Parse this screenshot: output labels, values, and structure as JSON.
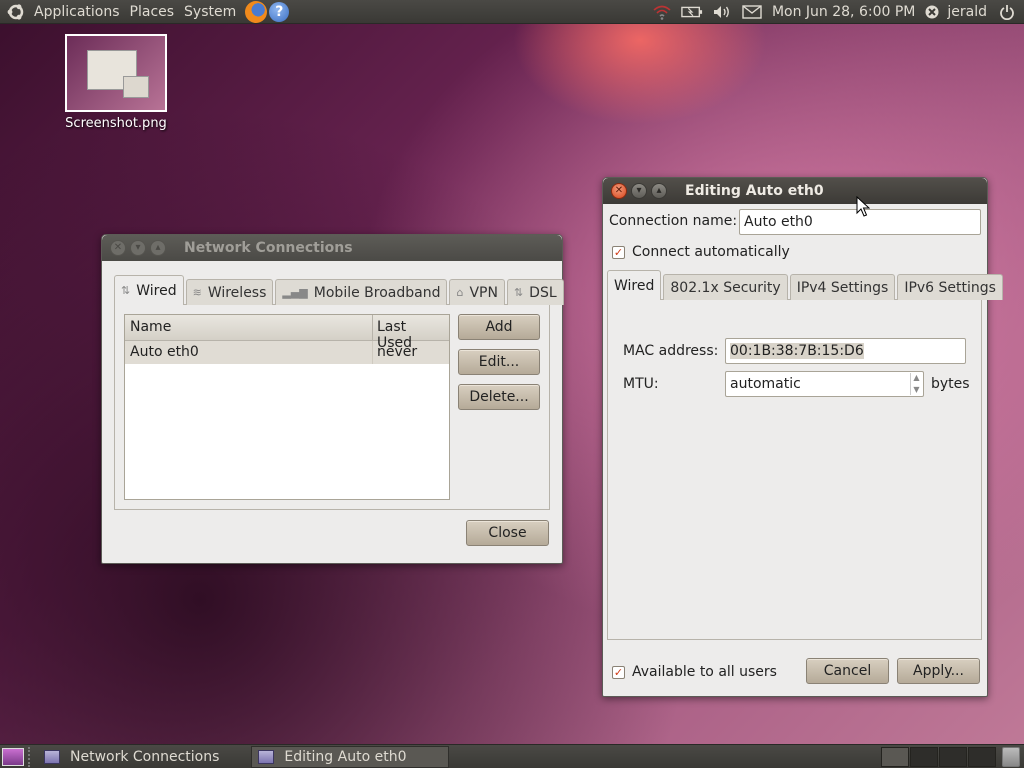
{
  "top_panel": {
    "menus": [
      "Applications",
      "Places",
      "System"
    ],
    "clock": "Mon Jun 28,  6:00 PM",
    "user": "jerald"
  },
  "desktop": {
    "icons": [
      {
        "label": "Screenshot.png"
      }
    ]
  },
  "network_window": {
    "title": "Network Connections",
    "tabs": [
      {
        "label": "Wired",
        "icon": "wired-icon"
      },
      {
        "label": "Wireless",
        "icon": "wireless-icon"
      },
      {
        "label": "Mobile Broadband",
        "icon": "mobile-broadband-icon"
      },
      {
        "label": "VPN",
        "icon": "vpn-lock-icon"
      },
      {
        "label": "DSL",
        "icon": "dsl-icon"
      }
    ],
    "table": {
      "columns": [
        "Name",
        "Last Used"
      ],
      "rows": [
        {
          "name": "Auto eth0",
          "last_used": "never"
        }
      ]
    },
    "buttons": {
      "add": "Add",
      "edit": "Edit...",
      "delete": "Delete...",
      "close": "Close"
    }
  },
  "edit_window": {
    "title": "Editing Auto eth0",
    "connection_name_label": "Connection name:",
    "connection_name_value": "Auto eth0",
    "connect_auto_label": "Connect automatically",
    "connect_auto_checked": true,
    "tabs": [
      "Wired",
      "802.1x Security",
      "IPv4 Settings",
      "IPv6 Settings"
    ],
    "mac_label": "MAC address:",
    "mac_value": "00:1B:38:7B:15:D6",
    "mtu_label": "MTU:",
    "mtu_value": "automatic",
    "mtu_unit": "bytes",
    "available_label": "Available to all users",
    "available_checked": true,
    "cancel": "Cancel",
    "apply": "Apply..."
  },
  "bottom_panel": {
    "tasks": [
      "Network Connections",
      "Editing Auto eth0"
    ]
  },
  "colors": {
    "accent_orange": "#d6461c",
    "button_tan": "#b5aa98"
  }
}
